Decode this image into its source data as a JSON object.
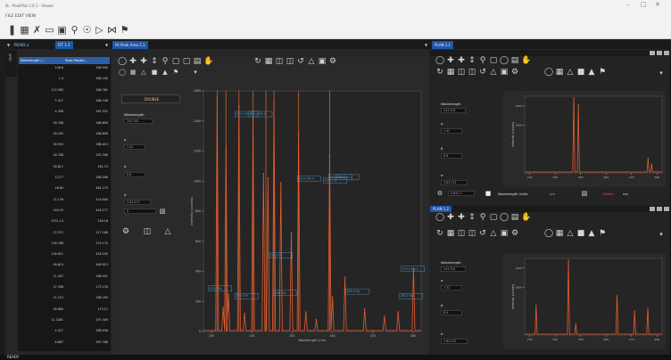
{
  "app": {
    "title": "fb - PeakPlot 2.0.1 - Viewer",
    "menu": "FILE  EDIT  VIEW"
  },
  "toolbar": {
    "icons": [
      "logo-icon",
      "grid-icon",
      "cross-icon",
      "chart-icon",
      "camera-icon",
      "search-icon",
      "target-icon",
      "play-icon",
      "split-icon",
      "flag-icon"
    ]
  },
  "tabs": {
    "left_strip": "SPEC",
    "main_left": "PEAKS x",
    "main_mid": "FIT 1.1",
    "main_right": "Fit Peak Area 1.1",
    "right_top": "PLAN 1.1",
    "right_bottom": "PLAN 1.2"
  },
  "table": {
    "headers": [
      "Wavelength (...",
      "Peak Positio..."
    ],
    "rows": [
      [
        "146.6",
        "268.590"
      ],
      [
        "1.4",
        "268.330"
      ],
      [
        "113.363",
        "268.361"
      ],
      [
        "5.317",
        "268.336"
      ],
      [
        "4.308",
        "267.531"
      ],
      [
        "18.708",
        "266.699"
      ],
      [
        "16.295",
        "266.656"
      ],
      [
        "18.594",
        "268.015"
      ],
      [
        "18.708",
        "252.596"
      ],
      [
        "18.611",
        "181.74"
      ],
      [
        "12.17",
        "188.508"
      ],
      [
        "16.65",
        "461.179"
      ],
      [
        "11.176",
        "419.000"
      ],
      [
        "140.55",
        "418.177"
      ],
      [
        "1231.14",
        "248.16"
      ],
      [
        "17.572",
        "217.168"
      ],
      [
        "116.788",
        "219.175"
      ],
      [
        "116.611",
        "418.195"
      ],
      [
        "16.614",
        "448.015"
      ],
      [
        "11.407",
        "186.551"
      ],
      [
        "17.398",
        "173.130"
      ],
      [
        "11.714",
        "186.183"
      ],
      [
        "18.880",
        "173.11"
      ],
      [
        "11.1081",
        "197.509"
      ],
      [
        "4.517",
        "288.036"
      ],
      [
        "8.667",
        "267.188"
      ]
    ]
  },
  "params": {
    "header": "DOUBLE",
    "wavelength_label": "Wavelength",
    "wavelength_value": "243.351",
    "p2_label": "μ",
    "p2_value": "1.52",
    "p3_label": "α",
    "p3_value": "6.8",
    "p4_label": "σ",
    "p4_value": "3.84.221",
    "p5_value": "0"
  },
  "right_params": {
    "wavelength_label": "Wavelength",
    "wavelength_value": "243.351",
    "a_label": "α",
    "a_value": "1.52",
    "b_label": "β",
    "b_value": "8.9",
    "c_label": "σ",
    "c_value": "3.84.221"
  },
  "bottom_bar_top_right": {
    "left_value": "0.841.2",
    "center_label": "Wavelength Units",
    "unit_value": "nm",
    "peak_label": "Select",
    "peak_value": "nm"
  },
  "status": {
    "text": "READY"
  },
  "colors": {
    "accent": "#2d5fa8",
    "peak": "#e85d2e",
    "annotation": "#4aa3d8",
    "cursor": "#b85b30"
  },
  "chart_data": [
    {
      "type": "line",
      "title": "",
      "xlabel": "Wavelength (nm)",
      "ylabel": "Intensity (counts)",
      "xlim": [
        228,
        282
      ],
      "ylim": [
        0,
        1600
      ],
      "x_ticks": [
        "230",
        "240",
        "250",
        "260",
        "270",
        "280"
      ],
      "y_ticks": [
        "0",
        "200",
        "400",
        "600",
        "800",
        "1000",
        "1200",
        "1400",
        "1600"
      ],
      "peaks": [
        {
          "x": 231.4,
          "y": 1560
        },
        {
          "x": 232.9,
          "y": 160
        },
        {
          "x": 233.6,
          "y": 1230
        },
        {
          "x": 234.2,
          "y": 250
        },
        {
          "x": 236.8,
          "y": 1500
        },
        {
          "x": 238.2,
          "y": 120
        },
        {
          "x": 240.3,
          "y": 1420
        },
        {
          "x": 242.9,
          "y": 1050
        },
        {
          "x": 244.0,
          "y": 1020
        },
        {
          "x": 245.5,
          "y": 1520
        },
        {
          "x": 247.2,
          "y": 990
        },
        {
          "x": 249.8,
          "y": 660
        },
        {
          "x": 251.6,
          "y": 1320
        },
        {
          "x": 253.4,
          "y": 130
        },
        {
          "x": 256.0,
          "y": 80
        },
        {
          "x": 259.3,
          "y": 1170
        },
        {
          "x": 260.0,
          "y": 230
        },
        {
          "x": 263.1,
          "y": 360
        },
        {
          "x": 268.0,
          "y": 150
        },
        {
          "x": 272.9,
          "y": 100
        },
        {
          "x": 276.3,
          "y": 130
        },
        {
          "x": 280.1,
          "y": 420
        }
      ],
      "cursor_lines": [
        231.4,
        233.6,
        236.8,
        240.3,
        243.5,
        245.5,
        251.6,
        259.3
      ],
      "annotations": [
        {
          "text": "235.3 Mn II",
          "x": 236.0,
          "y": 1440
        },
        {
          "text": "238.4 Mn II",
          "x": 239.5,
          "y": 1440
        },
        {
          "text": "251.0 Mn II",
          "x": 251.5,
          "y": 1010
        },
        {
          "text": "259.5 Mn II",
          "x": 259.3,
          "y": 1020
        },
        {
          "text": "252.1 Si",
          "x": 258.0,
          "y": 1000
        },
        {
          "text": "257.6 Mn II",
          "x": 261.0,
          "y": 1020
        },
        {
          "text": "243.0 Ti",
          "x": 244.5,
          "y": 500
        },
        {
          "text": "233.5 Fe",
          "x": 229.5,
          "y": 280
        },
        {
          "text": "239.1 Fe",
          "x": 236.0,
          "y": 230
        },
        {
          "text": "248.3 Fe",
          "x": 245.5,
          "y": 250
        },
        {
          "text": "262.4 Mg",
          "x": 263.5,
          "y": 260
        },
        {
          "text": "280.3 Mg",
          "x": 276.8,
          "y": 230
        },
        {
          "text": "279.5 Mg II",
          "x": 277.3,
          "y": 410
        }
      ]
    },
    {
      "type": "line",
      "title": "",
      "xlabel": "",
      "ylabel": "Intensity (counts)",
      "xlim": [
        228,
        282
      ],
      "ylim": [
        0,
        1600
      ],
      "x_ticks": [
        "230",
        "240",
        "250",
        "260",
        "270",
        "280"
      ],
      "y_ticks": [
        "1000",
        "1400"
      ],
      "peaks": [
        {
          "x": 247.3,
          "y": 1560
        },
        {
          "x": 249.1,
          "y": 1420
        },
        {
          "x": 276.5,
          "y": 300
        },
        {
          "x": 277.9,
          "y": 180
        }
      ]
    },
    {
      "type": "line",
      "title": "",
      "xlabel": "",
      "ylabel": "Intensity (counts)",
      "xlim": [
        228,
        282
      ],
      "ylim": [
        0,
        1600
      ],
      "x_ticks": [
        "230",
        "240",
        "250",
        "260",
        "270",
        "280"
      ],
      "y_ticks": [
        "1000",
        "1400"
      ],
      "peaks": [
        {
          "x": 232.5,
          "y": 620
        },
        {
          "x": 245.2,
          "y": 1560
        },
        {
          "x": 248.1,
          "y": 230
        },
        {
          "x": 264.3,
          "y": 820
        },
        {
          "x": 271.2,
          "y": 500
        },
        {
          "x": 276.4,
          "y": 560
        }
      ]
    }
  ]
}
